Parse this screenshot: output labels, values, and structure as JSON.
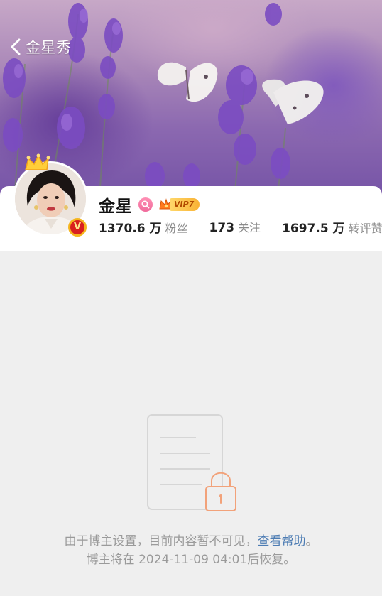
{
  "header": {
    "title": "金星秀"
  },
  "profile": {
    "name": "金星",
    "vip_label": "VIP7",
    "verified_mark": "V",
    "stats": [
      {
        "value": "1370.6 万",
        "label": "粉丝"
      },
      {
        "value": "173",
        "label": "关注"
      },
      {
        "value": "1697.5 万",
        "label": "转评赞"
      }
    ]
  },
  "private_notice": {
    "text_before": "由于博主设置，目前内容暂不可见，",
    "help_link": "查看帮助",
    "text_after": "。",
    "restore_line": "博主将在 2024-11-09 04:01后恢复。"
  },
  "colors": {
    "link": "#4d7cb3",
    "lock": "#f2a27a",
    "verified_badge": "#d9201e",
    "vip_gold": "#f9b234",
    "background": "#efefef"
  },
  "icons": {
    "back": "chevron-left-icon",
    "search_badge": "magnifier-icon",
    "vip_crown": "crown-icon",
    "avatar_crown": "crown-icon",
    "verified": "verified-v-icon",
    "lock": "lock-icon",
    "document": "document-icon"
  }
}
